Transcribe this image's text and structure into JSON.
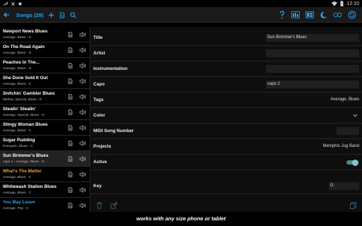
{
  "status_bar": {
    "time": "12:10"
  },
  "app_bar": {
    "back_icon": "arrow-left",
    "title": "Songs (29)",
    "actions": [
      "add-icon",
      "document-icon",
      "search-icon",
      "help-icon",
      "bars-icon",
      "grid-icon",
      "moon-icon",
      "loop-icon",
      "sync-icon"
    ],
    "accent": "#29a3ef"
  },
  "songs": [
    {
      "name": "Newport News Blues",
      "sub": "Average, Blues - G",
      "color": "#ffffff"
    },
    {
      "name": "On The Road Again",
      "sub": "Average, Blues - D",
      "color": "#ffffff"
    },
    {
      "name": "Peaches In The...",
      "sub": "Average, Blues - G",
      "color": "#ffffff"
    },
    {
      "name": "She Done Sold It Out",
      "sub": "Average, Blues - C",
      "color": "#ffffff"
    },
    {
      "name": "Snitchin' Gambler Blues",
      "sub": "Mellow, Special, Blues - E",
      "color": "#ffffff"
    },
    {
      "name": "Stealin' Stealin'",
      "sub": "Average, Special, Blues - G",
      "color": "#ffffff"
    },
    {
      "name": "Stingy Woman Blues",
      "sub": "Average, Blues - C",
      "color": "#ffffff"
    },
    {
      "name": "Sugar Pudding",
      "sub": "Energetic, Blues - C",
      "color": "#ffffff"
    },
    {
      "name": "Sun Brimmer's Blues",
      "sub": "capo 2 - Average, Blues - G",
      "color": "#ffffff",
      "selected": true
    },
    {
      "name": "What's The Matter",
      "sub": "Average, Blues - C",
      "color": "#f0a030"
    },
    {
      "name": "Whitewash Station Blues",
      "sub": "Average, Blues - C",
      "color": "#ffffff"
    },
    {
      "name": "You May Leave",
      "sub": "Average, Pop - C",
      "color": "#29a3ef"
    }
  ],
  "detail": {
    "title_label": "Title",
    "title_value": "Sun Brimmer's Blues",
    "artist_label": "Artist",
    "artist_value": "",
    "instrumentation_label": "Instrumentation",
    "instrumentation_value": "",
    "capo_label": "Capo",
    "capo_value": "capo 2",
    "tags_label": "Tags",
    "tags_value": "Average, Blues",
    "color_label": "Color",
    "midi_label": "MIDI Song Number",
    "projects_label": "Projects",
    "projects_value": "Memphis Jug Band",
    "active_label": "Active",
    "active_value": true,
    "key_label": "Key",
    "key_value": "G"
  },
  "caption": "works with any size phone or tablet"
}
